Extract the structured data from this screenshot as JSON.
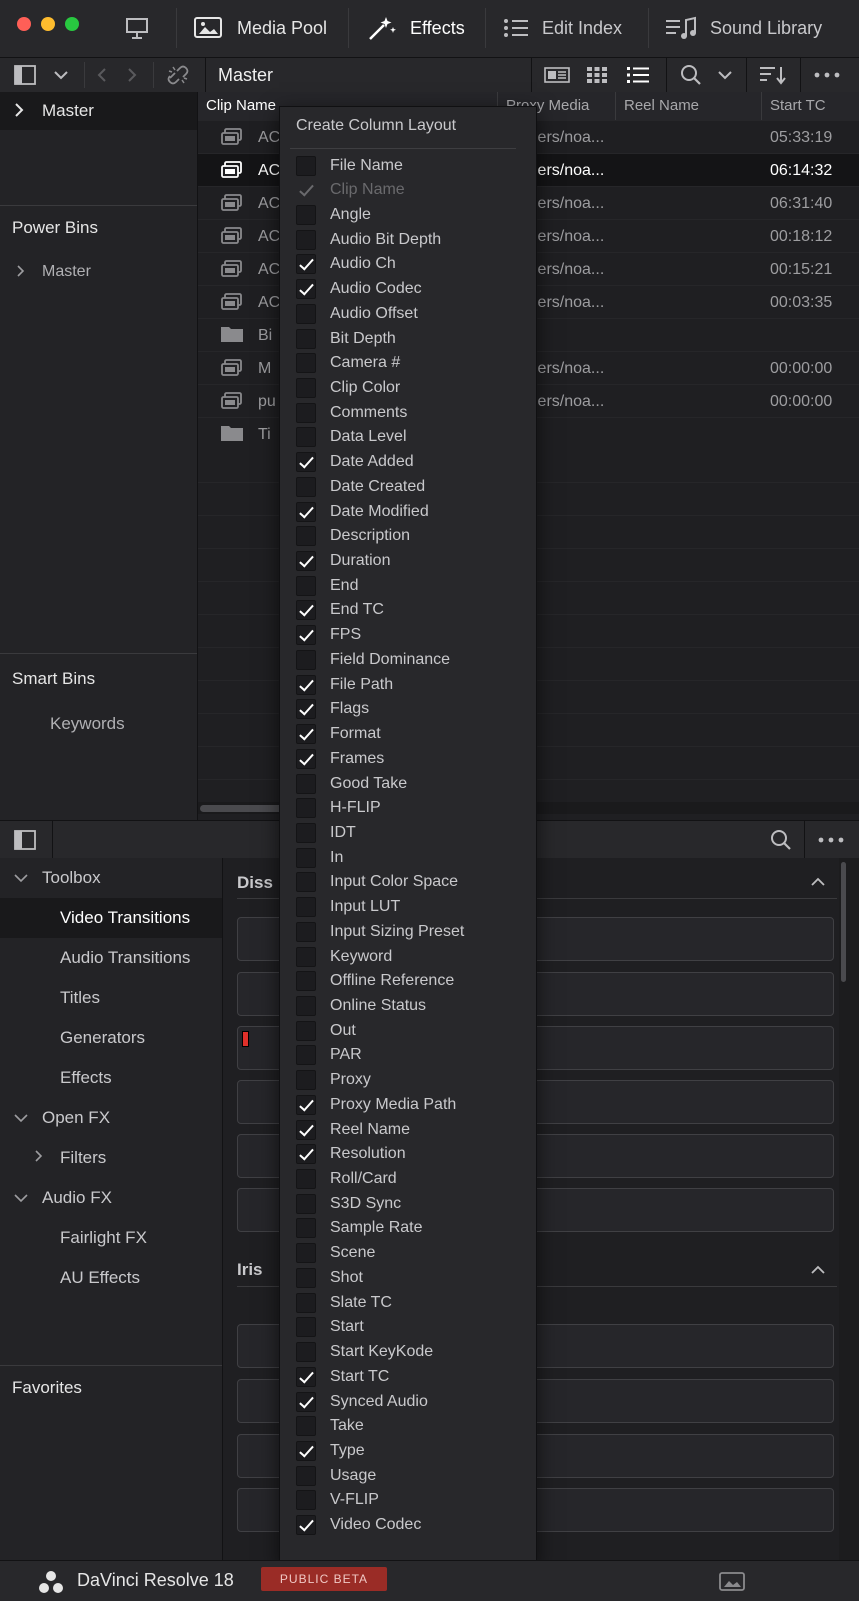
{
  "toolbar": {
    "media_pool": "Media Pool",
    "effects": "Effects",
    "edit_index": "Edit Index",
    "sound_library": "Sound Library"
  },
  "bin_bar": {
    "title": "Master"
  },
  "left_panel": {
    "master": "Master",
    "power_bins": "Power Bins",
    "power_master": "Master",
    "smart_bins": "Smart Bins",
    "keywords": "Keywords"
  },
  "table": {
    "columns": [
      "Clip Name",
      "Proxy Media",
      "Reel Name",
      "Start TC"
    ],
    "rows": [
      {
        "name": "AC",
        "proxy": "Users/noa...",
        "tc": "05:33:19"
      },
      {
        "name": "AC",
        "proxy": "Users/noa...",
        "tc": "06:14:32"
      },
      {
        "name": "AC",
        "proxy": "Users/noa...",
        "tc": "06:31:40"
      },
      {
        "name": "AC",
        "proxy": "Users/noa...",
        "tc": "00:18:12"
      },
      {
        "name": "AC",
        "proxy": "Users/noa...",
        "tc": "00:15:21"
      },
      {
        "name": "AC",
        "proxy": "Users/noa...",
        "tc": "00:03:35"
      },
      {
        "name": "Bi",
        "proxy": "",
        "tc": ""
      },
      {
        "name": "M",
        "proxy": "Users/noa...",
        "tc": "00:00:00"
      },
      {
        "name": "pu",
        "proxy": "Users/noa...",
        "tc": "00:00:00"
      },
      {
        "name": "Ti",
        "proxy": "",
        "tc": ""
      }
    ]
  },
  "toolbox": {
    "toolbox": "Toolbox",
    "video_transitions": "Video Transitions",
    "audio_transitions": "Audio Transitions",
    "titles": "Titles",
    "generators": "Generators",
    "effects": "Effects",
    "open_fx": "Open FX",
    "filters": "Filters",
    "audio_fx": "Audio FX",
    "fairlight_fx": "Fairlight FX",
    "au_effects": "AU Effects",
    "favorites": "Favorites"
  },
  "effects_panel": {
    "dissolve_header": "Diss",
    "iris_header": "Iris"
  },
  "menu": {
    "title": "Create Column Layout",
    "items": [
      {
        "label": "File Name",
        "checked": false
      },
      {
        "label": "Clip Name",
        "checked": true,
        "disabled": true
      },
      {
        "label": "Angle",
        "checked": false
      },
      {
        "label": "Audio Bit Depth",
        "checked": false
      },
      {
        "label": "Audio Ch",
        "checked": true
      },
      {
        "label": "Audio Codec",
        "checked": true
      },
      {
        "label": "Audio Offset",
        "checked": false
      },
      {
        "label": "Bit Depth",
        "checked": false
      },
      {
        "label": "Camera #",
        "checked": false
      },
      {
        "label": "Clip Color",
        "checked": false
      },
      {
        "label": "Comments",
        "checked": false
      },
      {
        "label": "Data Level",
        "checked": false
      },
      {
        "label": "Date Added",
        "checked": true
      },
      {
        "label": "Date Created",
        "checked": false
      },
      {
        "label": "Date Modified",
        "checked": true
      },
      {
        "label": "Description",
        "checked": false
      },
      {
        "label": "Duration",
        "checked": true
      },
      {
        "label": "End",
        "checked": false
      },
      {
        "label": "End TC",
        "checked": true
      },
      {
        "label": "FPS",
        "checked": true
      },
      {
        "label": "Field Dominance",
        "checked": false
      },
      {
        "label": "File Path",
        "checked": true
      },
      {
        "label": "Flags",
        "checked": true
      },
      {
        "label": "Format",
        "checked": true
      },
      {
        "label": "Frames",
        "checked": true
      },
      {
        "label": "Good Take",
        "checked": false
      },
      {
        "label": "H-FLIP",
        "checked": false
      },
      {
        "label": "IDT",
        "checked": false
      },
      {
        "label": "In",
        "checked": false
      },
      {
        "label": "Input Color Space",
        "checked": false
      },
      {
        "label": "Input LUT",
        "checked": false
      },
      {
        "label": "Input Sizing Preset",
        "checked": false
      },
      {
        "label": "Keyword",
        "checked": false
      },
      {
        "label": "Offline Reference",
        "checked": false
      },
      {
        "label": "Online Status",
        "checked": false
      },
      {
        "label": "Out",
        "checked": false
      },
      {
        "label": "PAR",
        "checked": false
      },
      {
        "label": "Proxy",
        "checked": false
      },
      {
        "label": "Proxy Media Path",
        "checked": true
      },
      {
        "label": "Reel Name",
        "checked": true
      },
      {
        "label": "Resolution",
        "checked": true
      },
      {
        "label": "Roll/Card",
        "checked": false
      },
      {
        "label": "S3D Sync",
        "checked": false
      },
      {
        "label": "Sample Rate",
        "checked": false
      },
      {
        "label": "Scene",
        "checked": false
      },
      {
        "label": "Shot",
        "checked": false
      },
      {
        "label": "Slate TC",
        "checked": false
      },
      {
        "label": "Start",
        "checked": false
      },
      {
        "label": "Start KeyKode",
        "checked": false
      },
      {
        "label": "Start TC",
        "checked": true
      },
      {
        "label": "Synced Audio",
        "checked": true
      },
      {
        "label": "Take",
        "checked": false
      },
      {
        "label": "Type",
        "checked": true
      },
      {
        "label": "Usage",
        "checked": false
      },
      {
        "label": "V-FLIP",
        "checked": false
      },
      {
        "label": "Video Codec",
        "checked": true
      }
    ]
  },
  "status_bar": {
    "app_name": "DaVinci Resolve 18",
    "badge": "PUBLIC BETA"
  },
  "colors": {
    "background": "#1f1f22",
    "panel": "#28282b",
    "badge": "#9a2c26",
    "traffic_red": "#ff5f57",
    "traffic_yellow": "#febc2e",
    "traffic_green": "#28c840",
    "marker_red": "#e0302a"
  },
  "icons": [
    "monitor-icon",
    "media-pool-icon",
    "effects-wand-icon",
    "edit-index-icon",
    "sound-library-icon",
    "sidebar-toggle-icon",
    "chevron-down-icon",
    "back-icon",
    "forward-icon",
    "unlink-icon",
    "metadata-view-icon",
    "thumbnail-view-icon",
    "list-view-icon",
    "search-icon",
    "sort-icon",
    "more-icon",
    "clip-icon",
    "folder-icon",
    "davinci-logo-icon",
    "viewer-icon"
  ]
}
